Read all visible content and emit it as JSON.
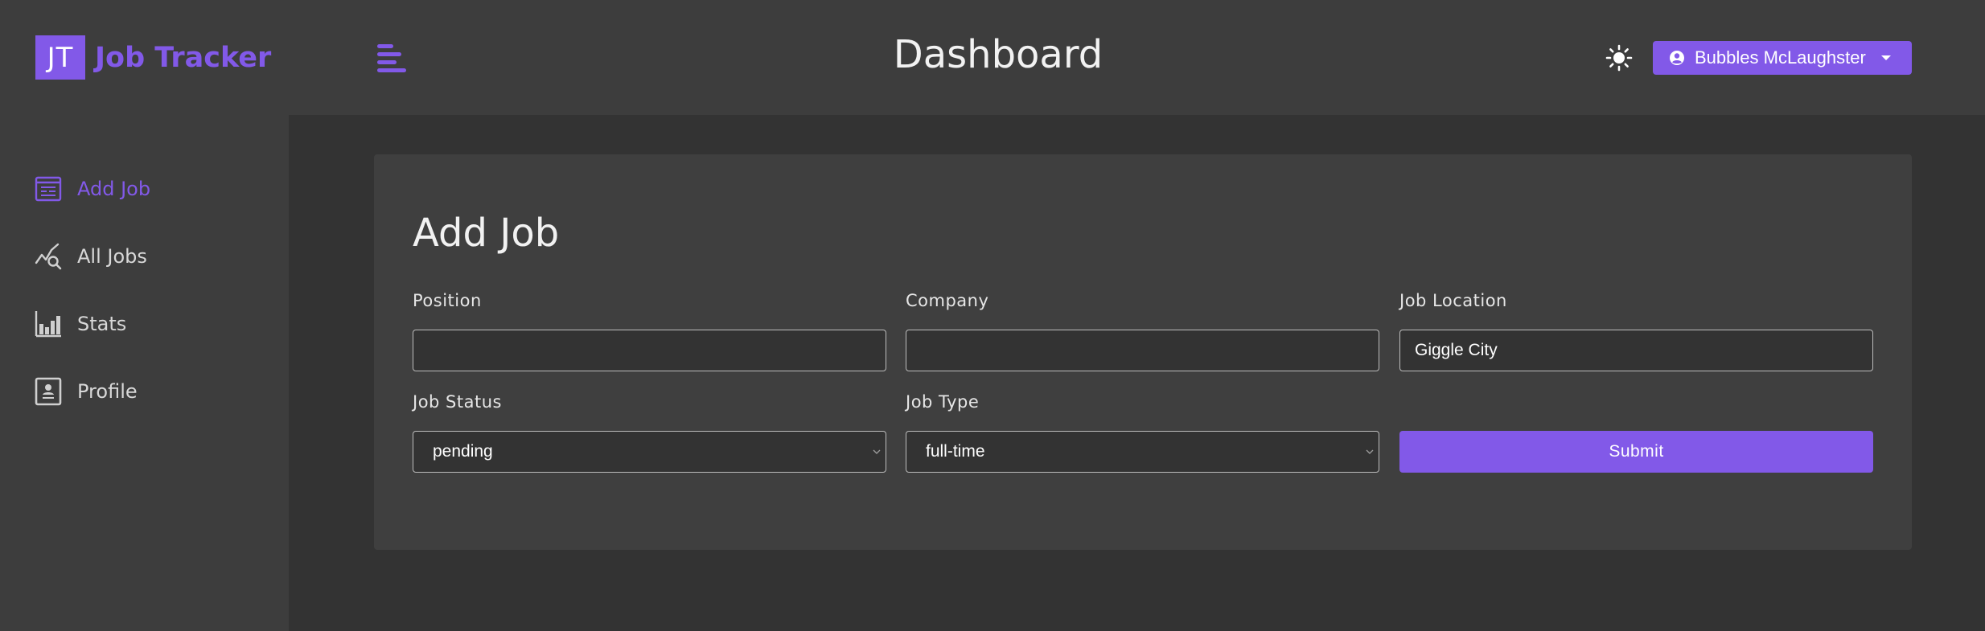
{
  "header": {
    "logo_initials": "JT",
    "logo_text": "Job Tracker",
    "page_title": "Dashboard",
    "user_name": "Bubbles McLaughster",
    "icons": [
      "menu-toggle-icon",
      "sun-icon",
      "user-circle-icon",
      "caret-down-icon"
    ]
  },
  "sidebar": {
    "items": [
      {
        "label": "Add Job",
        "icon": "add-job-form-icon",
        "active": true
      },
      {
        "label": "All Jobs",
        "icon": "search-chart-icon",
        "active": false
      },
      {
        "label": "Stats",
        "icon": "bar-chart-icon",
        "active": false
      },
      {
        "label": "Profile",
        "icon": "profile-card-icon",
        "active": false
      }
    ]
  },
  "form": {
    "title": "Add Job",
    "position": {
      "label": "Position",
      "value": ""
    },
    "company": {
      "label": "Company",
      "value": ""
    },
    "location": {
      "label": "Job Location",
      "value": "Giggle City"
    },
    "status": {
      "label": "Job Status",
      "value": "pending"
    },
    "type": {
      "label": "Job Type",
      "value": "full-time"
    },
    "submit_label": "Submit"
  },
  "colors": {
    "accent": "#8259e8",
    "background": "#333333",
    "panel": "#3d3d3d",
    "card": "#3f3f3f",
    "text": "#e8e8e8"
  }
}
